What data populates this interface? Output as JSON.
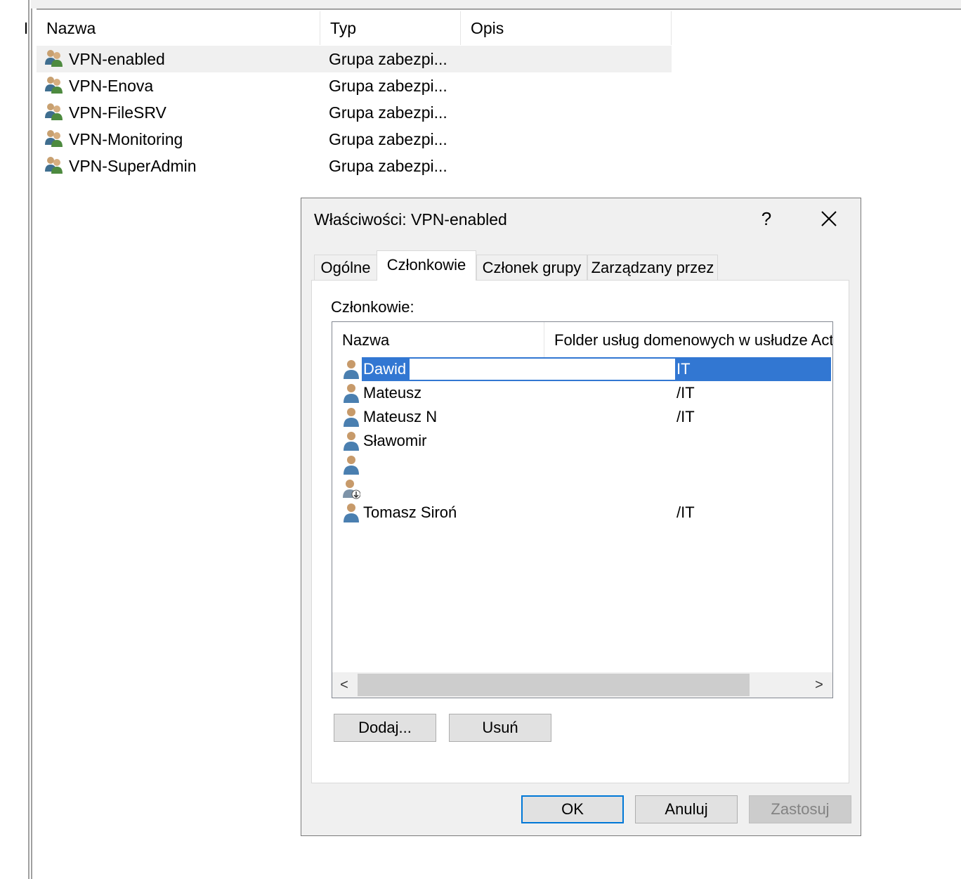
{
  "list": {
    "columns": {
      "name": "Nazwa",
      "type": "Typ",
      "description": "Opis"
    },
    "groups": [
      {
        "name": "VPN-enabled",
        "type": "Grupa zabezpi..."
      },
      {
        "name": "VPN-Enova",
        "type": "Grupa zabezpi..."
      },
      {
        "name": "VPN-FileSRV",
        "type": "Grupa zabezpi..."
      },
      {
        "name": "VPN-Monitoring",
        "type": "Grupa zabezpi..."
      },
      {
        "name": "VPN-SuperAdmin",
        "type": "Grupa zabezpi..."
      }
    ],
    "selected_group": "VPN-enabled",
    "group_icon": "group-icon"
  },
  "dialog": {
    "title": "Właściwości: VPN-enabled",
    "help_label": "?",
    "close_icon": "close-icon",
    "tabs": [
      "Ogólne",
      "Członkowie",
      "Członek grupy",
      "Zarządzany przez"
    ],
    "active_tab": "Członkowie",
    "members_label": "Członkowie:",
    "members_columns": {
      "name": "Nazwa",
      "folder": "Folder usług domenowych w usłudze Acti"
    },
    "members": [
      {
        "name": "Dawid",
        "folder": "IT",
        "icon": "user-icon",
        "selected": true
      },
      {
        "name": "Mateusz",
        "folder": "/IT",
        "icon": "user-icon"
      },
      {
        "name": "Mateusz N",
        "folder": "/IT",
        "icon": "user-icon"
      },
      {
        "name": "Sławomir",
        "folder": "",
        "icon": "user-icon"
      },
      {
        "name": "",
        "folder": "",
        "icon": "user-icon"
      },
      {
        "name": "",
        "folder": "",
        "icon": "contact-user-icon"
      },
      {
        "name": "Tomasz Siroń",
        "folder": "/IT",
        "icon": "user-icon"
      }
    ],
    "scroll_left_label": "<",
    "scroll_right_label": ">",
    "add_button": "Dodaj...",
    "remove_button": "Usuń",
    "ok_button": "OK",
    "cancel_button": "Anuluj",
    "apply_button": "Zastosuj",
    "selection_color": "#3277d2",
    "default_button_border": "#0078d7"
  }
}
